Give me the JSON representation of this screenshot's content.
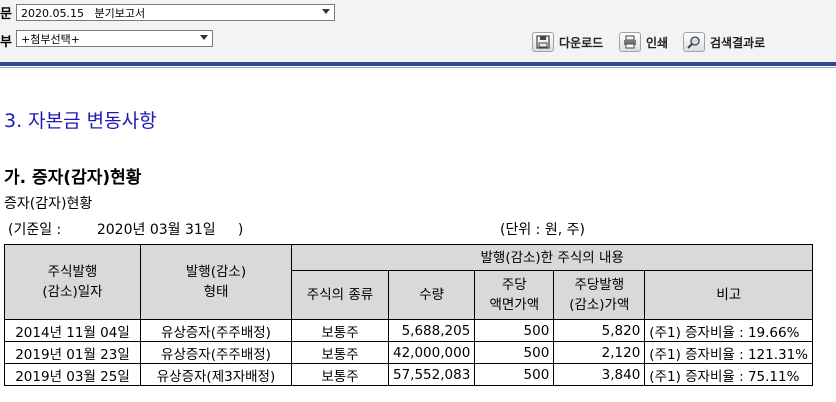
{
  "toolbar": {
    "report_label": "문",
    "report_select": "2020.05.15   분기보고서",
    "attach_label": "부",
    "attach_select": "+첨부선택+",
    "download": "다운로드",
    "print": "인쇄",
    "search_results": "검색결과로"
  },
  "section_title": "3. 자본금 변동사항",
  "subsection_title": "가. 증자(감자)현황",
  "table_caption": "증자(감자)현황",
  "base_date": "(기준일 :        2020년 03월 31일     )",
  "unit": "(단위 : 원, 주)",
  "table": {
    "headers": {
      "issue_date": "주식발행\n(감소)일자",
      "issue_type": "발행(감소)\n형태",
      "group": "발행(감소)한 주식의 내용",
      "stock_kind": "주식의 종류",
      "quantity": "수량",
      "par_value": "주당\n액면가액",
      "issue_price": "주당발행\n(감소)가액",
      "note": "비고"
    },
    "rows": [
      {
        "date": "2014년 11월 04일",
        "type": "유상증자(주주배정)",
        "kind": "보통주",
        "qty": "5,688,205",
        "par": "500",
        "price": "5,820",
        "note": "(주1) 증자비율 : 19.66%"
      },
      {
        "date": "2019년 01월 23일",
        "type": "유상증자(주주배정)",
        "kind": "보통주",
        "qty": "42,000,000",
        "par": "500",
        "price": "2,120",
        "note": "(주1) 증자비율 : 121.31%"
      },
      {
        "date": "2019년 03월 25일",
        "type": "유상증자(제3자배정)",
        "kind": "보통주",
        "qty": "57,552,083",
        "par": "500",
        "price": "3,840",
        "note": "(주1) 증자비율 : 75.11%"
      }
    ]
  }
}
